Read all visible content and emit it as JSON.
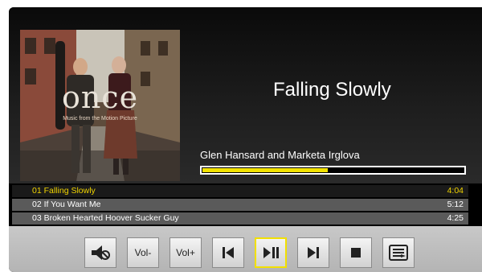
{
  "now_playing": {
    "title": "Falling Slowly",
    "artist": "Glen Hansard and Marketa Irglova",
    "progress": 0.48
  },
  "album_art": {
    "title": "once",
    "subtitle": "Music from the Motion Picture"
  },
  "playlist": [
    {
      "title": "01 Falling Slowly",
      "duration": "4:04",
      "active": true
    },
    {
      "title": "02 If You Want Me",
      "duration": "5:12",
      "active": false
    },
    {
      "title": "03 Broken Hearted Hoover Sucker Guy",
      "duration": "4:25",
      "active": false
    }
  ],
  "controls": {
    "vol_down_label": "Vol-",
    "vol_up_label": "Vol+"
  },
  "colors": {
    "accent": "#f2e200",
    "active_text": "#f2d500",
    "toolbar_bg": "#c0c0c0"
  }
}
